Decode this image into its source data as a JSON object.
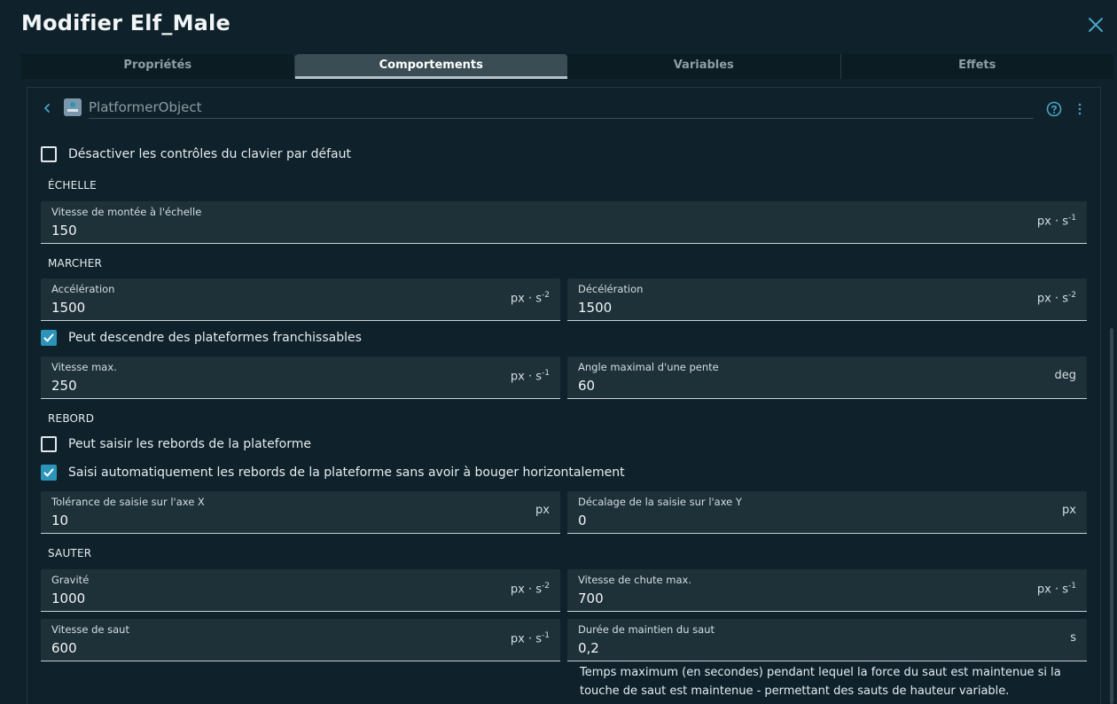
{
  "dialog": {
    "title": "Modifier Elf_Male"
  },
  "tabs": [
    {
      "label": "Propriétés"
    },
    {
      "label": "Comportements"
    },
    {
      "label": "Variables"
    },
    {
      "label": "Effets"
    }
  ],
  "behavior": {
    "name": "PlatformerObject"
  },
  "options": {
    "disable_keyboard": "Désactiver les contrôles du clavier par défaut",
    "ladder_section": "ÉCHELLE",
    "ladder_speed": {
      "label": "Vitesse de montée à l'échelle",
      "value": "150",
      "unit": "px · s",
      "exp": "-1"
    },
    "walk_section": "MARCHER",
    "acceleration": {
      "label": "Accélération",
      "value": "1500",
      "unit": "px · s",
      "exp": "-2"
    },
    "deceleration": {
      "label": "Décélération",
      "value": "1500",
      "unit": "px · s",
      "exp": "-2"
    },
    "go_down_platforms": "Peut descendre des plateformes franchissables",
    "max_speed": {
      "label": "Vitesse max.",
      "value": "250",
      "unit": "px · s",
      "exp": "-1"
    },
    "max_slope": {
      "label": "Angle maximal d'une pente",
      "value": "60",
      "unit": "deg"
    },
    "ledge_section": "REBORD",
    "grab_ledges": "Peut saisir les rebords de la plateforme",
    "auto_grab": "Saisi automatiquement les rebords de la plateforme sans avoir à bouger horizontalement",
    "grab_tolerance": {
      "label": "Tolérance de saisie sur l'axe X",
      "value": "10",
      "unit": "px"
    },
    "grab_offset": {
      "label": "Décalage de la saisie sur l'axe Y",
      "value": "0",
      "unit": "px"
    },
    "jump_section": "SAUTER",
    "gravity": {
      "label": "Gravité",
      "value": "1000",
      "unit": "px · s",
      "exp": "-2"
    },
    "max_fall": {
      "label": "Vitesse de chute max.",
      "value": "700",
      "unit": "px · s",
      "exp": "-1"
    },
    "jump_speed": {
      "label": "Vitesse de saut",
      "value": "600",
      "unit": "px · s",
      "exp": "-1"
    },
    "jump_sustain": {
      "label": "Durée de maintien du saut",
      "value": "0,2",
      "unit": "s"
    },
    "jump_sustain_help": "Temps maximum (en secondes) pendant lequel la force du saut est maintenue si la touche de saut est maintenue - permettant des sauts de hauteur variable."
  },
  "checks": {
    "disable_keyboard": false,
    "go_down_platforms": true,
    "grab_ledges": false,
    "auto_grab": true
  },
  "colors": {
    "background": "#0f222b",
    "field": "#1e3139",
    "accent": "#2c94b9"
  },
  "icons": {
    "close": "close-icon",
    "back": "chevron-left-icon",
    "behavior": "platformer-behavior-icon",
    "help": "help-circle-icon",
    "more": "more-vertical-icon",
    "check": "checkmark-icon"
  }
}
